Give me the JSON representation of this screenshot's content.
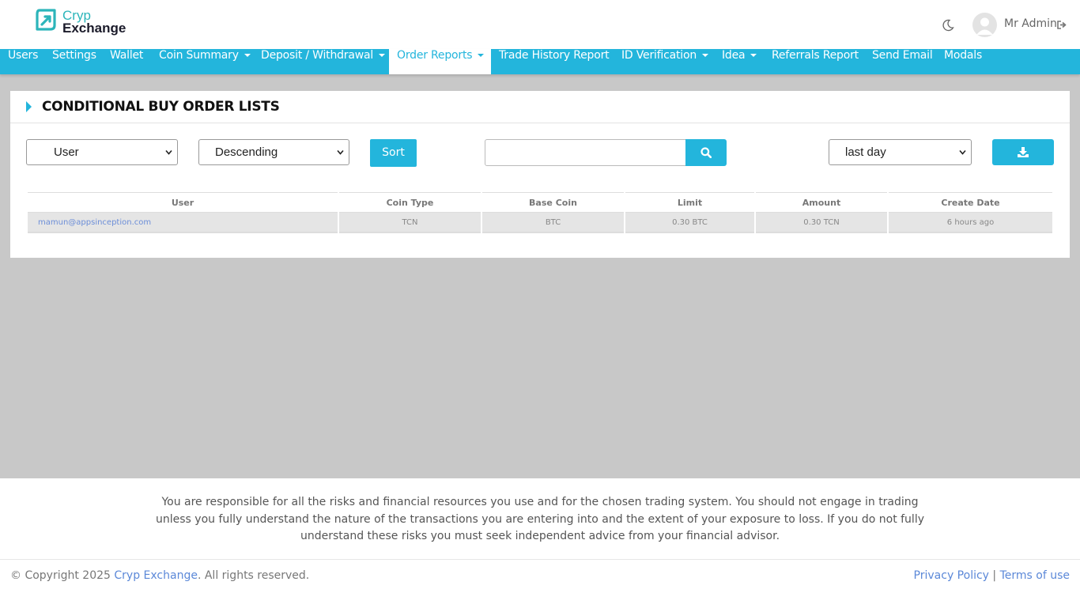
{
  "brand": {
    "line1": "Cryp",
    "line2": "Exchange",
    "accent": "#2cb5ba"
  },
  "header": {
    "theme_icon": "moon-icon",
    "user_name": "Mr Admin",
    "logout_icon": "sign-out-icon"
  },
  "nav": {
    "color": "#23b5dc",
    "items": [
      {
        "label": "Users"
      },
      {
        "label": "Settings"
      },
      {
        "label": "Wallet"
      },
      {
        "label": "Coin Summary",
        "dropdown": true
      },
      {
        "label": "Deposit / Withdrawal",
        "dropdown": true
      },
      {
        "label": "Order Reports",
        "dropdown": true,
        "active": true
      },
      {
        "label": "Trade History Report"
      },
      {
        "label": "ID Verification",
        "dropdown": true
      },
      {
        "label": "Idea",
        "dropdown": true
      },
      {
        "label": "Referrals Report"
      },
      {
        "label": "Send Email"
      },
      {
        "label": "Modals"
      }
    ]
  },
  "panel": {
    "title": "CONDITIONAL BUY ORDER LISTS",
    "sort_field": {
      "selected": "User"
    },
    "sort_order": {
      "selected": "Descending"
    },
    "sort_button": "Sort",
    "search": {
      "value": "",
      "placeholder": "",
      "icon": "search-icon"
    },
    "period": {
      "selected": "last day"
    },
    "download_icon": "download-icon"
  },
  "table": {
    "columns": [
      "User",
      "Coin Type",
      "Base Coin",
      "Limit",
      "Amount",
      "Create Date"
    ],
    "rows": [
      [
        "mamun@appsinception.com",
        "TCN",
        "BTC",
        "0.30 BTC",
        "0.30 TCN",
        "6 hours ago"
      ]
    ]
  },
  "disclaimer": "You are responsible for all the risks and financial resources you use and for the chosen trading system. You should not engage in trading unless you fully understand the nature of the transactions you are entering into and the extent of your exposure to loss. If you do not fully understand these risks you must seek independent advice from your financial advisor.",
  "footer": {
    "copyright_prefix": "© Copyright 2025 ",
    "copyright_brand": "Cryp Exchange",
    "copyright_suffix": ". All rights reserved.",
    "privacy": "Privacy Policy",
    "separator": " | ",
    "terms": "Terms of use"
  }
}
